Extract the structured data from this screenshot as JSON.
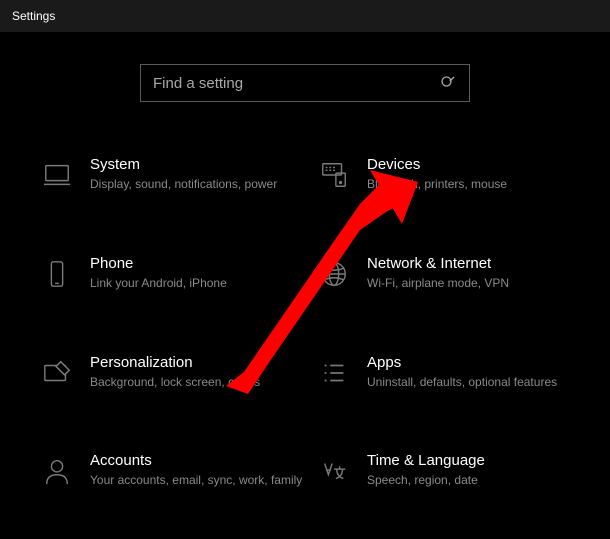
{
  "titlebar": {
    "title": "Settings"
  },
  "search": {
    "placeholder": "Find a setting"
  },
  "tiles": {
    "system": {
      "title": "System",
      "subtitle": "Display, sound, notifications, power"
    },
    "devices": {
      "title": "Devices",
      "subtitle": "Bluetooth, printers, mouse"
    },
    "phone": {
      "title": "Phone",
      "subtitle": "Link your Android, iPhone"
    },
    "network": {
      "title": "Network & Internet",
      "subtitle": "Wi-Fi, airplane mode, VPN"
    },
    "personalization": {
      "title": "Personalization",
      "subtitle": "Background, lock screen, colors"
    },
    "apps": {
      "title": "Apps",
      "subtitle": "Uninstall, defaults, optional features"
    },
    "accounts": {
      "title": "Accounts",
      "subtitle": "Your accounts, email, sync, work, family"
    },
    "time": {
      "title": "Time & Language",
      "subtitle": "Speech, region, date"
    }
  },
  "annotation": {
    "arrow_color": "#ff0000",
    "points_to": "devices"
  }
}
